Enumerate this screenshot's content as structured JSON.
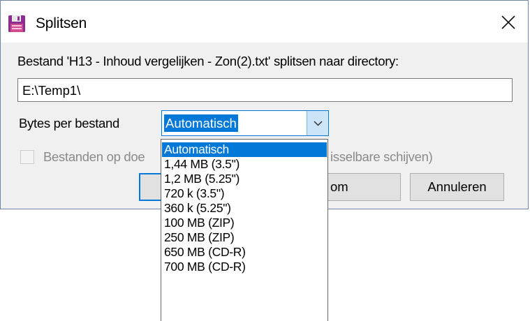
{
  "window": {
    "title": "Splitsen",
    "close_icon": "close-icon",
    "app_icon": "floppy-disk-icon"
  },
  "split_prompt": "Bestand 'H13 - Inhoud vergelijken - Zon(2).txt' splitsen naar directory:",
  "target_directory": "E:\\Temp1\\",
  "bytes_per_file": {
    "label": "Bytes per bestand",
    "selected": "Automatisch",
    "arrow_icon": "chevron-down-icon",
    "options": [
      "Automatisch",
      "1,44 MB (3.5\")",
      "1,2 MB (5.25\")",
      "720 k (3.5\")",
      "360 k (5.25\")",
      "100 MB (ZIP)",
      "250 MB (ZIP)",
      "650 MB (CD-R)",
      "700 MB (CD-R)"
    ]
  },
  "checkbox": {
    "label_left": "Bestanden op doe",
    "label_right": "isselbare schijven)",
    "checked": false,
    "enabled": false
  },
  "buttons": {
    "ok_label": "",
    "middle_label_fragment": "om",
    "cancel_label": "Annuleren"
  },
  "colors": {
    "accent": "#0078d7",
    "dialog_bg": "#f0f0f0",
    "disabled_text": "#8a8a8a"
  }
}
